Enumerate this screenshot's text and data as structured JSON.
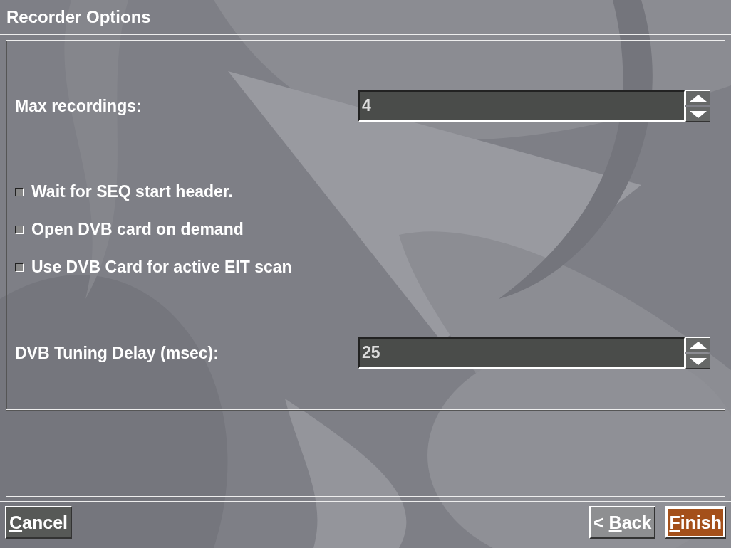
{
  "window": {
    "title": "Recorder Options"
  },
  "settings": [
    {
      "kind": "spinbox",
      "label": "Max recordings:",
      "value": "4"
    },
    {
      "kind": "checkbox",
      "label": "Wait for SEQ start header.",
      "checked": false
    },
    {
      "kind": "checkbox",
      "label": "Open DVB card on demand",
      "checked": false
    },
    {
      "kind": "checkbox",
      "label": "Use DVB Card for active EIT scan",
      "checked": false
    },
    {
      "kind": "spinbox",
      "label": "DVB Tuning Delay (msec):",
      "value": "25"
    }
  ],
  "buttons": [
    {
      "parts": [
        {
          "text": "C",
          "underlined": true
        },
        {
          "text": "ancel",
          "underlined": false
        }
      ],
      "focused": false,
      "dimmed": false
    },
    {
      "parts": [
        {
          "text": "< ",
          "underlined": false
        },
        {
          "text": "B",
          "underlined": true
        },
        {
          "text": "ack",
          "underlined": false
        }
      ],
      "focused": false,
      "dimmed": true
    },
    {
      "parts": [
        {
          "text": "F",
          "underlined": true
        },
        {
          "text": "inish",
          "underlined": false
        }
      ],
      "focused": true,
      "dimmed": false
    }
  ]
}
